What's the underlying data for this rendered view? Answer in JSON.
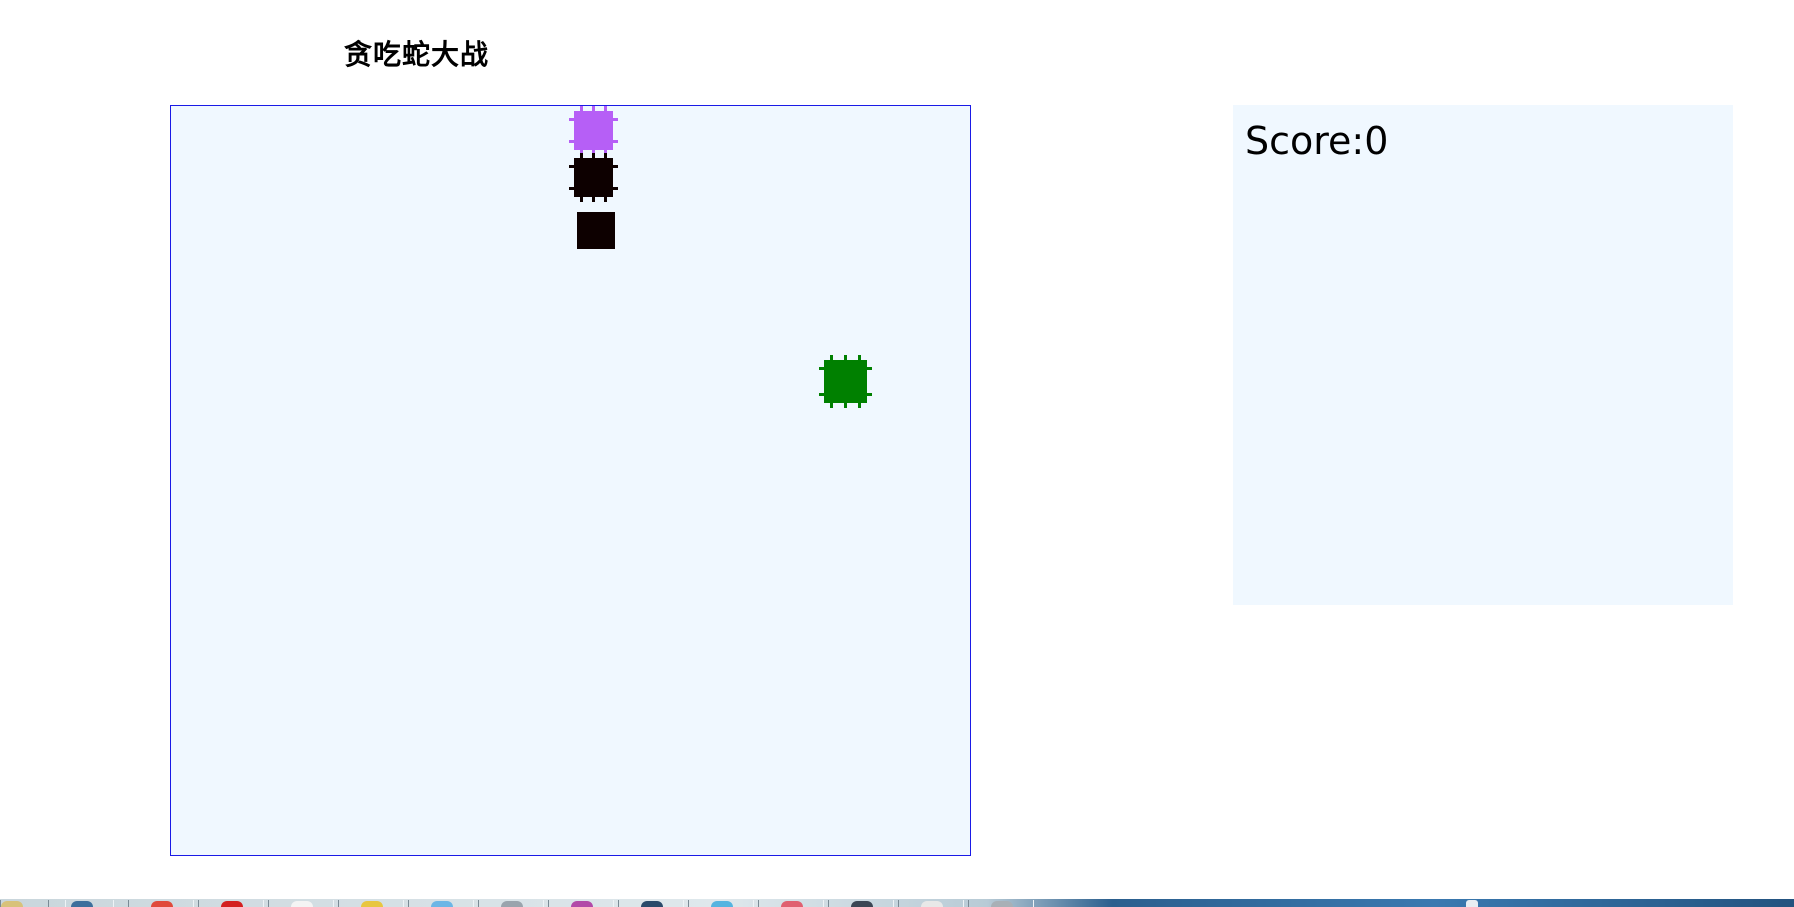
{
  "page": {
    "title": "贪吃蛇大战"
  },
  "board": {
    "background": "#f0f8ff",
    "border_color": "#1a1ae6",
    "snake": {
      "head_color": "#b65ff6",
      "body_color": "#0d0000",
      "segments": [
        "head",
        "body",
        "tail"
      ]
    },
    "food": {
      "color": "#008000"
    }
  },
  "score_panel": {
    "text": "Score:0"
  },
  "taskbar": {
    "icons": [
      "folder-icon",
      "app-icon",
      "chrome-icon",
      "red-app-icon",
      "blank-app-icon",
      "yellow-app-icon",
      "blue-app-icon",
      "gray-app-icon",
      "purple-app-icon",
      "dark-app-icon",
      "globe-icon",
      "red-pin-icon",
      "dark-round-icon",
      "doc-icon",
      "gray-folder-icon"
    ]
  }
}
